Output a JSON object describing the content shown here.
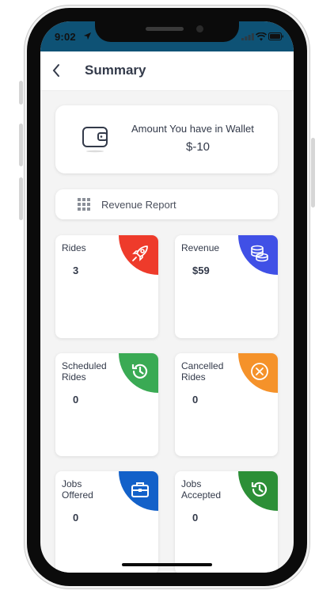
{
  "status_bar": {
    "time": "9:02"
  },
  "header": {
    "title": "Summary"
  },
  "wallet": {
    "label": "Amount You have in Wallet",
    "amount": "$-10"
  },
  "report": {
    "label": "Revenue Report"
  },
  "tiles": [
    {
      "line1": "Rides",
      "line2": "",
      "value": "3",
      "icon": "rocket-icon",
      "color": "#ee3b2b"
    },
    {
      "line1": "Revenue",
      "line2": "",
      "value": "$59",
      "icon": "coins-icon",
      "color": "#4050e6"
    },
    {
      "line1": "Scheduled",
      "line2": "Rides",
      "value": "0",
      "icon": "history-icon",
      "color": "#3aaa54"
    },
    {
      "line1": "Cancelled",
      "line2": "Rides",
      "value": "0",
      "icon": "cancel-circle-icon",
      "color": "#f5922a"
    },
    {
      "line1": "Jobs",
      "line2": "Offered",
      "value": "0",
      "icon": "briefcase-icon",
      "color": "#1361c9"
    },
    {
      "line1": "Jobs",
      "line2": "Accepted",
      "value": "0",
      "icon": "history-icon",
      "color": "#2c8f37"
    }
  ],
  "colors": {
    "status_bar": "#0e5275",
    "text": "#333a4a"
  }
}
